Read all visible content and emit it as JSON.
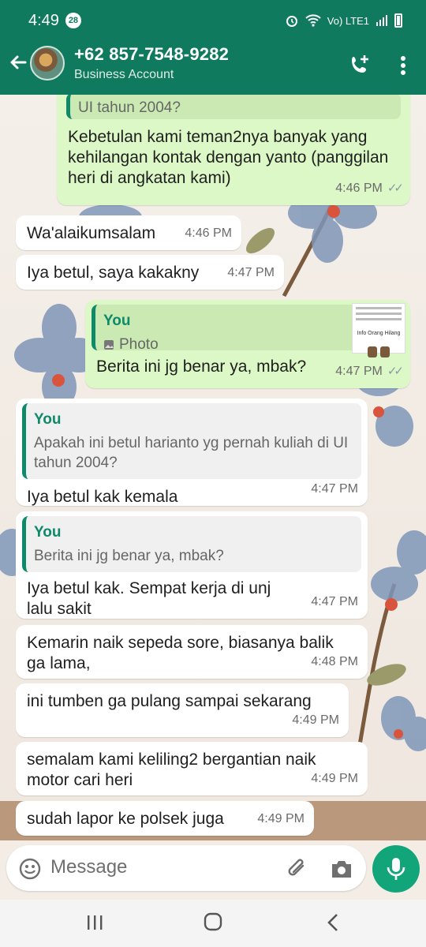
{
  "status": {
    "time": "4:49",
    "notification_count": "28",
    "network": "Vo) LTE1"
  },
  "header": {
    "contact_name": "+62 857-7548-9282",
    "subtitle": "Business Account"
  },
  "messages": [
    {
      "text": "UI tahun 2004?",
      "time": ""
    },
    {
      "text": "Kebetulan kami teman2nya banyak yang kehilangan kontak dengan yanto (panggilan heri di angkatan kami)",
      "time": "4:46 PM"
    },
    {
      "text": "Wa'alaikumsalam",
      "time": "4:46 PM"
    },
    {
      "text": "Iya betul, saya kakakny",
      "time": "4:47 PM"
    },
    {
      "quote_author": "You",
      "quote_text": "Photo",
      "thumb_caption": "Info Orang Hilang",
      "text": "Berita ini jg benar ya, mbak?",
      "time": "4:47 PM"
    },
    {
      "quote_author": "You",
      "quote_text": "Apakah ini betul harianto yg pernah kuliah di UI tahun 2004?",
      "text": "Iya betul kak kemala",
      "time": "4:47 PM"
    },
    {
      "quote_author": "You",
      "quote_text": "Berita ini jg benar ya, mbak?",
      "text": "Iya betul kak. Sempat kerja di unj lalu sakit",
      "time": "4:47 PM"
    },
    {
      "text": "Kemarin naik sepeda sore, biasanya balik ga lama,",
      "time": "4:48 PM"
    },
    {
      "text": "ini tumben ga pulang sampai sekarang",
      "time": "4:49 PM"
    },
    {
      "text": "semalam kami keliling2 bergantian naik motor cari heri",
      "time": "4:49 PM"
    },
    {
      "text": "sudah lapor ke polsek juga",
      "time": "4:49 PM"
    }
  ],
  "input": {
    "placeholder": "Message"
  },
  "colors": {
    "header": "#0f7a5e",
    "outgoing": "#dcf8c6",
    "incoming": "#ffffff",
    "accent": "#0e8a6a",
    "mic": "#12a57a"
  },
  "icons": [
    "back-arrow-icon",
    "add-call-icon",
    "more-vert-icon",
    "emoji-icon",
    "attach-icon",
    "camera-icon",
    "mic-icon",
    "image-icon",
    "double-check-icon"
  ]
}
